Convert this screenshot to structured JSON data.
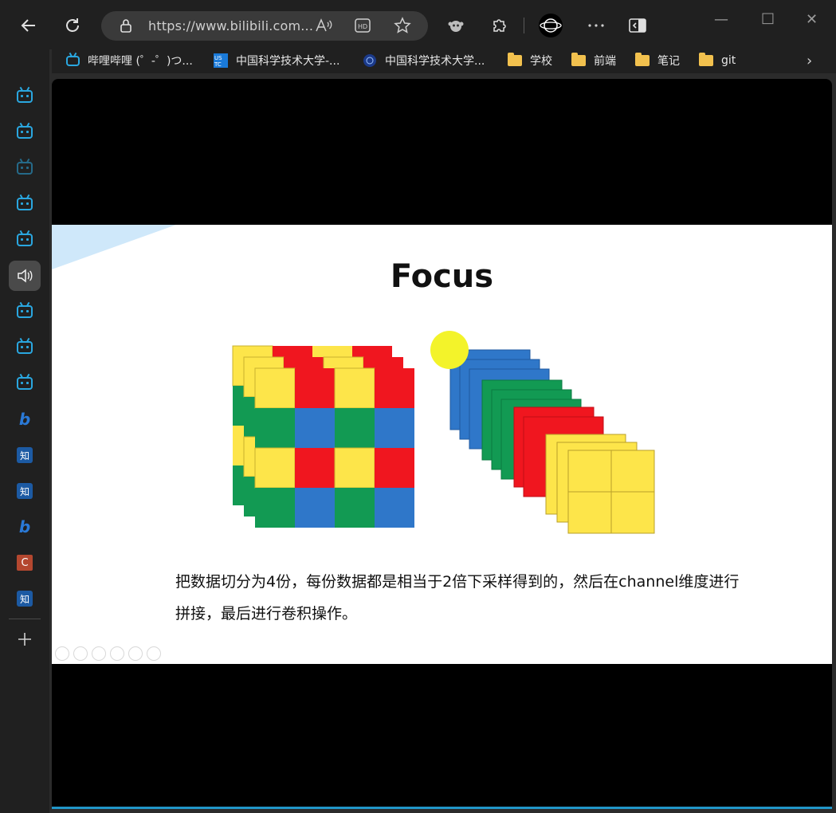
{
  "browser": {
    "url": "https://www.bilibili.com..."
  },
  "bookmarks": [
    {
      "label": "哔哩哔哩 (゜-゜)つ...",
      "icon": "bilibili-icon"
    },
    {
      "label": "中国科学技术大学-...",
      "icon": "ustc-icon"
    },
    {
      "label": "中国科学技术大学...",
      "icon": "ustc-globe-icon"
    },
    {
      "label": "学校",
      "icon": "folder-icon"
    },
    {
      "label": "前端",
      "icon": "folder-icon"
    },
    {
      "label": "笔记",
      "icon": "folder-icon"
    },
    {
      "label": "git",
      "icon": "folder-icon"
    }
  ],
  "sidebar": {
    "items": [
      {
        "icon": "bilibili-icon"
      },
      {
        "icon": "bilibili-icon"
      },
      {
        "icon": "bilibili-icon"
      },
      {
        "icon": "bilibili-icon"
      },
      {
        "icon": "bilibili-icon"
      },
      {
        "icon": "speaker-icon",
        "active": true
      },
      {
        "icon": "bilibili-icon"
      },
      {
        "icon": "bilibili-icon"
      },
      {
        "icon": "bilibili-icon"
      },
      {
        "icon": "bing-icon"
      },
      {
        "icon": "zhihu-icon",
        "text": "知"
      },
      {
        "icon": "zhihu-icon",
        "text": "知"
      },
      {
        "icon": "bing-icon"
      },
      {
        "icon": "csdn-icon",
        "text": "C"
      },
      {
        "icon": "zhihu-icon",
        "text": "知"
      }
    ]
  },
  "slide": {
    "title": "Focus",
    "caption_line1": "把数据切分为4份，每份数据都是相当于2倍下采样得到的，然后在channel维度进行",
    "caption_line2": "拼接，最后进行卷积操作。"
  },
  "colors": {
    "yellow": "#fde54a",
    "red": "#f0161f",
    "green": "#129a53",
    "blue": "#2f77c9",
    "accent": "#2aa7e0"
  }
}
